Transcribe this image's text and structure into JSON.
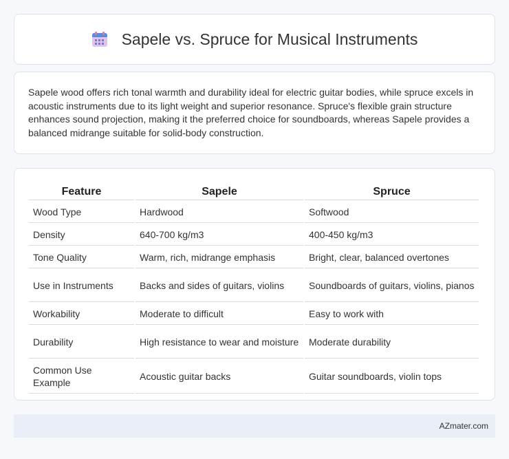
{
  "header": {
    "title": "Sapele vs. Spruce for Musical Instruments",
    "icon": "calendar-icon"
  },
  "intro": {
    "text": "Sapele wood offers rich tonal warmth and durability ideal for electric guitar bodies, while spruce excels in acoustic instruments due to its light weight and superior resonance. Spruce's flexible grain structure enhances sound projection, making it the preferred choice for soundboards, whereas Sapele provides a balanced midrange suitable for solid-body construction."
  },
  "table": {
    "headers": [
      "Feature",
      "Sapele",
      "Spruce"
    ],
    "rows": [
      [
        "Wood Type",
        "Hardwood",
        "Softwood"
      ],
      [
        "Density",
        "640-700 kg/m3",
        "400-450 kg/m3"
      ],
      [
        "Tone Quality",
        "Warm, rich, midrange emphasis",
        "Bright, clear, balanced overtones"
      ],
      [
        "Use in Instruments",
        "Backs and sides of guitars, violins",
        "Soundboards of guitars, violins, pianos"
      ],
      [
        "Workability",
        "Moderate to difficult",
        "Easy to work with"
      ],
      [
        "Durability",
        "High resistance to wear and moisture",
        "Moderate durability"
      ],
      [
        "Common Use Example",
        "Acoustic guitar backs",
        "Guitar soundboards, violin tops"
      ]
    ]
  },
  "footer": {
    "brand": "AZmater.com"
  }
}
